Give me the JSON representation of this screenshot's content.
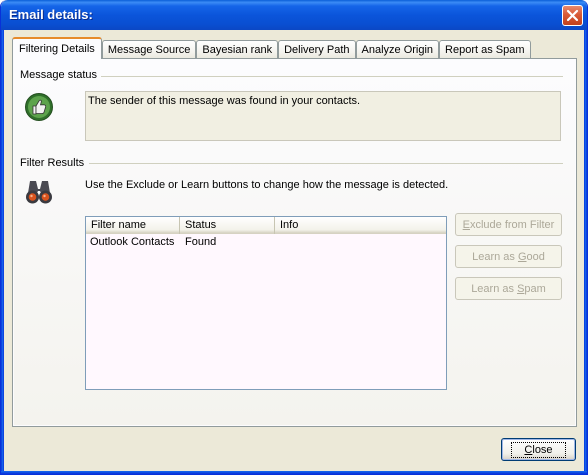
{
  "window": {
    "title": "Email details:",
    "close_glyph": "✕"
  },
  "tabs": [
    {
      "label": "Filtering Details",
      "active": true
    },
    {
      "label": "Message Source",
      "active": false
    },
    {
      "label": "Bayesian rank",
      "active": false
    },
    {
      "label": "Delivery Path",
      "active": false
    },
    {
      "label": "Analyze Origin",
      "active": false
    },
    {
      "label": "Report as Spam",
      "active": false
    }
  ],
  "message_status": {
    "heading": "Message status",
    "icon": "thumbs-up-icon",
    "text": "The sender of this message was found in your contacts."
  },
  "filter_results": {
    "heading": "Filter Results",
    "icon": "binoculars-icon",
    "hint": "Use the Exclude or Learn buttons to change how the message is detected.",
    "columns": [
      "Filter name",
      "Status",
      "Info"
    ],
    "rows": [
      {
        "filter_name": "Outlook Contacts",
        "status": "Found",
        "info": ""
      }
    ]
  },
  "actions": {
    "exclude": {
      "before": "",
      "key": "E",
      "after": "xclude from Filter"
    },
    "learn_good": {
      "before": "Learn as ",
      "key": "G",
      "after": "ood"
    },
    "learn_spam": {
      "before": "Learn as ",
      "key": "S",
      "after": "pam"
    },
    "close": {
      "before": "",
      "key": "C",
      "after": "lose"
    }
  },
  "colors": {
    "titlebar": "#0a4fd2",
    "active_tab_accent": "#e68b2c",
    "list_background": "#fff8fe",
    "disabled_text": "#aca899"
  }
}
